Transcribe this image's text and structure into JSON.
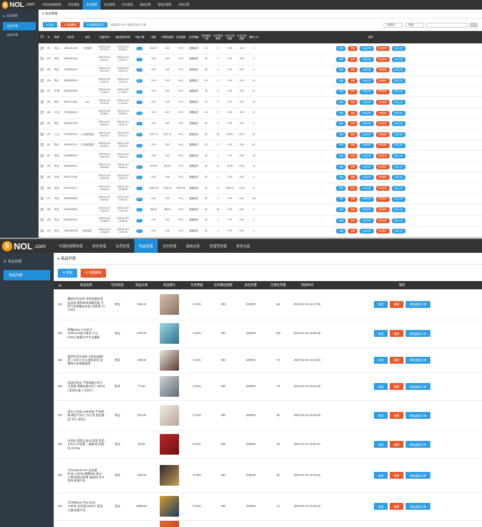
{
  "shot1": {
    "logo": {
      "digit": "6",
      "text": "NOL",
      "suffix": ".com"
    },
    "nav": [
      "代理商结算管理",
      "财务管理",
      "会员管理",
      "商品管理",
      "任务管理",
      "基础设置",
      "管理员管理",
      "系统设置"
    ],
    "nav_active": 2,
    "sidebar": {
      "head": "会员管理",
      "items": [
        "会员列表",
        "结单列表"
      ]
    },
    "crumb": "会员管理",
    "toolbar": {
      "add": "添加",
      "batch_delete": "批量删除",
      "batch_add": "批量添加会员",
      "hint": "总数会员 9073  当前页 会员 25  条"
    },
    "filters": [
      "--请选择--",
      "--筛选--"
    ],
    "headers": [
      "ID",
      "昵称",
      "手机号",
      "钱包",
      "注册时间",
      "最近登录时间",
      "下级人数",
      "余额",
      "可提现金额",
      "冻结金额",
      "会员等级",
      "任务单总人数",
      "今日完成单数",
      "今日已完成数",
      "今日已完成额",
      "推荐人ID",
      "操作"
    ],
    "row_actions": [
      "编辑",
      "删除",
      "资金记录",
      "修改密码",
      "设置上级"
    ],
    "rows": [
      [
        "174",
        "未名",
        "13812341234",
        "三彩会员",
        "2020-01-04 09:12:03",
        "2020-01-04 09:35:42",
        "0",
        "461.00",
        "0.00",
        "0.00",
        "普通会员",
        "30",
        "0",
        "0.00",
        "0.00",
        "0"
      ],
      [
        "173",
        "未名",
        "15697521018",
        "",
        "2020-01-04 09:10:21",
        "2020-01-04 09:10:21",
        "0",
        "0.00",
        "0.00",
        "0.00",
        "普通会员",
        "30",
        "0",
        "0.00",
        "0.00",
        "0"
      ],
      [
        "150",
        "未名",
        "17805236142",
        "",
        "2020-01-03 18:12:30",
        "2020-01-03 18:12:30",
        "0",
        "0.00",
        "0.00",
        "0.00",
        "普通会员",
        "30",
        "0",
        "0.00",
        "0.00",
        "0"
      ],
      [
        "148",
        "默认",
        "15835309925",
        "",
        "2020-01-03 17:52:13",
        "2020-01-03 17:52:13",
        "0",
        "0.00",
        "0.00",
        "0.00",
        "普通会员",
        "30",
        "0",
        "0.00",
        "0.00",
        "14"
      ],
      [
        "147",
        "不用",
        "15926343626",
        "",
        "2020-01-03 17:28:04",
        "2020-01-03 17:28:04",
        "0",
        "0.00",
        "0.00",
        "0.00",
        "普通会员",
        "30",
        "0",
        "0.00",
        "0.00",
        "42"
      ],
      [
        "146",
        "默认",
        "16316771851",
        "aan",
        "2020-01-03 17:02:40",
        "2020-01-03 17:02:40",
        "0",
        "0.00",
        "0.00",
        "0.00",
        "普通会员",
        "30",
        "0",
        "0.00",
        "0.00",
        "14"
      ],
      [
        "145",
        "小名",
        "17835226413",
        "",
        "2020-01-03 16:58:11",
        "2020-01-03 16:58:11",
        "0",
        "0.00",
        "0.00",
        "0.00",
        "普通会员",
        "30",
        "0",
        "0.00",
        "0.00",
        "70"
      ],
      [
        "144",
        "默认",
        "15835222163",
        "",
        "2020-01-03 16:42:07",
        "2020-01-03 16:42:21",
        "0",
        "0.00",
        "0.00",
        "0.00",
        "普通会员",
        "30",
        "0",
        "0.00",
        "0.00",
        "0"
      ],
      [
        "143",
        "小卫",
        "17813620734",
        "小卫测试会员",
        "2020-01-03 16:31:21",
        "2020-01-03 16:31:21",
        "0",
        "1927.73",
        "1927.73",
        "0.00",
        "普通会员",
        "30",
        "20",
        "25.00",
        "25.73",
        "87"
      ],
      [
        "142",
        "默认",
        "13026313714",
        "小宇测试会员",
        "2020-01-03 16:25:31",
        "2020-01-03 16:25:31",
        "0",
        "0.00",
        "0.00",
        "0.00",
        "普通会员",
        "30",
        "0",
        "0.00",
        "0.00",
        "81"
      ],
      [
        "141",
        "未名",
        "13326800379",
        "",
        "2020-01-03 15:57:03",
        "2020-01-03 15:57:03",
        "0",
        "0.00",
        "0.00",
        "0.00",
        "普通会员",
        "30",
        "0",
        "0.00",
        "0.00",
        "28"
      ],
      [
        "140",
        "未名",
        "15813626921",
        "",
        "2020-01-03 15:44:02",
        "2020-01-03 15:44:02",
        "0",
        "613.59",
        "613.59",
        "0.00",
        "普通会员",
        "30",
        "15",
        "15.00",
        "11.50",
        "14"
      ],
      [
        "138",
        "未名",
        "15252712261",
        "",
        "2020-01-03 15:22:30",
        "2020-01-03 15:22:30",
        "0",
        "0.00",
        "0.00",
        "0.00",
        "普通会员",
        "30",
        "0",
        "0.00",
        "0.00",
        "0"
      ],
      [
        "136",
        "未名",
        "15260716772",
        "",
        "2020-01-03 15:16:16",
        "2020-01-04 18:18:55",
        "0",
        "20933.75",
        "1987.95",
        "12937.80",
        "普通会员",
        "30",
        "11",
        "1260.00",
        "11.50",
        "8"
      ],
      [
        "137",
        "未名",
        "15803028826",
        "",
        "2020-01-03 14:53:41",
        "2020-01-03 14:53:41",
        "0",
        "0.00",
        "0.00",
        "0.00",
        "普通会员",
        "30",
        "0",
        "0.00",
        "0.00",
        "124"
      ],
      [
        "136",
        "未名",
        "13935028932",
        "",
        "2020-01-03 14:44:35",
        "2020-01-03 14:44:35",
        "0",
        "288.00",
        "288.00",
        "0.00",
        "普通会员",
        "30",
        "40",
        "0.00",
        "0.00",
        "0"
      ],
      [
        "135",
        "未名",
        "15324631547",
        "",
        "2020-01-03 14:38:08",
        "2020-01-03 14:38:08",
        "0",
        "0.00",
        "0.00",
        "0.00",
        "普通会员",
        "30",
        "0",
        "0.00",
        "0.00",
        "0"
      ],
      [
        "134",
        "未名",
        "13813659796",
        "测试会员",
        "2020-01-03 14:33:35",
        "2020-01-03 14:33:35",
        "0",
        "0.00",
        "0.00",
        "0.00",
        "普通会员",
        "30",
        "0",
        "0.00",
        "0.00",
        "0"
      ],
      [
        "133",
        "未名",
        "15612345890",
        "",
        "2020-01-03 14:30:16",
        "2020-01-03 14:30:16",
        "0",
        "0.00",
        "0.00",
        "0.00",
        "普通会员",
        "30",
        "0",
        "0.00",
        "0.00",
        "0"
      ]
    ]
  },
  "shot2": {
    "logo": {
      "digit": "6",
      "text": "NOL",
      "suffix": ".com"
    },
    "nav": [
      "代理商结算管理",
      "财务管理",
      "会员管理",
      "商品管理",
      "任务管理",
      "基础设置",
      "管理员管理",
      "系统设置"
    ],
    "nav_active": 3,
    "sidebar": {
      "head": "商品管理",
      "items": [
        "商品列表"
      ]
    },
    "crumb": "商品列表",
    "toolbar": {
      "add": "添加",
      "batch_delete": "批量删除"
    },
    "headers": [
      "ID",
      "商品名称",
      "任务类型",
      "商品价格",
      "商品图片",
      "任务佣金",
      "任务最低金额",
      "总任务量",
      "已接任务量",
      "添加时间",
      "操作"
    ],
    "row_actions": [
      "修改",
      "删除",
      "增加虚拟订单"
    ],
    "rows": [
      {
        "id": "441",
        "name": "露娃时尚女装 吊带显瘦修身连衣裙 夏季新款高腰显瘦 百搭气质收腰连衣裙 (浅粉黑 S)  128元",
        "type": "淘宝",
        "price": "299.00",
        "commission": "0.10%",
        "min": "200",
        "total": "100000",
        "taken": "66",
        "time": "2020-01-04 19:27:05",
        "img": [
          "#d8bfa8",
          "#8a7060"
        ]
      },
      {
        "id": "440",
        "name": "荣耀play3 6.39英寸 4000mAh超大电池 千元 6400万像素大片专业摄影",
        "type": "淘宝",
        "price": "879.00",
        "commission": "0.10%",
        "min": "200",
        "total": "100000",
        "taken": "110",
        "time": "2020-01-04 19:25:45",
        "img": [
          "#9fd8e8",
          "#2a6f8a"
        ]
      },
      {
        "id": "439",
        "name": "雷伊科蓝牙鼠标 无线充电静音 2.4GHz 办公游戏家用 轻薄笔记本电脑通用",
        "type": "拼多",
        "price": "199.00",
        "commission": "0.10%",
        "min": "200",
        "total": "100000",
        "taken": "74",
        "time": "2020-01-04 19:24:02",
        "img": [
          "#e9e6e2",
          "#5a3a2a"
        ]
      },
      {
        "id": "438",
        "name": "保温杯男女 不锈钢真空学生 大容量 便携车载水杯 ( 400ml ) 套装礼盒 ( 可刻字 )",
        "type": "拼多",
        "price": "77.64",
        "commission": "0.10%",
        "min": "200",
        "total": "100000",
        "taken": "76",
        "time": "2020-01-04 19:23:09",
        "img": [
          "#cfd4d8",
          "#5e6a72"
        ]
      },
      {
        "id": "437",
        "name": "迷你小风扇 USB充电 手持便携 静音大风力 办公室 宿舍桌面 学生 (粉色)",
        "type": "淘宝",
        "price": "319.00",
        "commission": "0.10%",
        "min": "200",
        "total": "100000",
        "taken": "98",
        "time": "2020-01-04 19:20:33",
        "img": [
          "#efe9e4",
          "#b8a896"
        ]
      },
      {
        "id": "436",
        "name": "洗衣机 滚筒全自动 变频 家用 10公斤大容量 一级能效 除菌洗 20.0kg",
        "type": "淘宝",
        "price": "90.00",
        "commission": "0.10%",
        "min": "200",
        "total": "100000",
        "taken": "26",
        "time": "2020-01-04 19:20:07",
        "img": [
          "#c0282a",
          "#6a1010"
        ]
      },
      {
        "id": "435",
        "name": "华为Mate30 5G 全网通 8GB+128GB 麒麟990 徕卡三摄 超感光影像 曲面屏 双卡双待 智能手机",
        "type": "淘宝",
        "price": "199.00",
        "commission": "0.10%",
        "min": "200",
        "total": "100000",
        "taken": "32",
        "time": "2020-01-04 19:19:34",
        "img": [
          "#2a2a2a",
          "#c89a5a"
        ]
      },
      {
        "id": "434",
        "name": "华为畅享10 Plus 6GB 128GB 全网通 4800万 超清三摄 智能手机",
        "type": "淘宝",
        "price": "5999.00",
        "commission": "0.10%",
        "min": "200",
        "total": "100000",
        "taken": "11",
        "time": "2020-01-04 19:19:13",
        "img": [
          "#d89a2a",
          "#1a3a6a"
        ]
      },
      {
        "id": "433",
        "name": "小龙虾 鲜活 冷冻 熟食 麻辣 十三香 口味 加热即食",
        "type": "淘宝",
        "price": "99.00",
        "commission": "0.10%",
        "min": "200",
        "total": "100000",
        "taken": "34",
        "time": "2020-01-04 19:18:46",
        "img": [
          "#e06a3a",
          "#b83a1a"
        ]
      }
    ]
  }
}
